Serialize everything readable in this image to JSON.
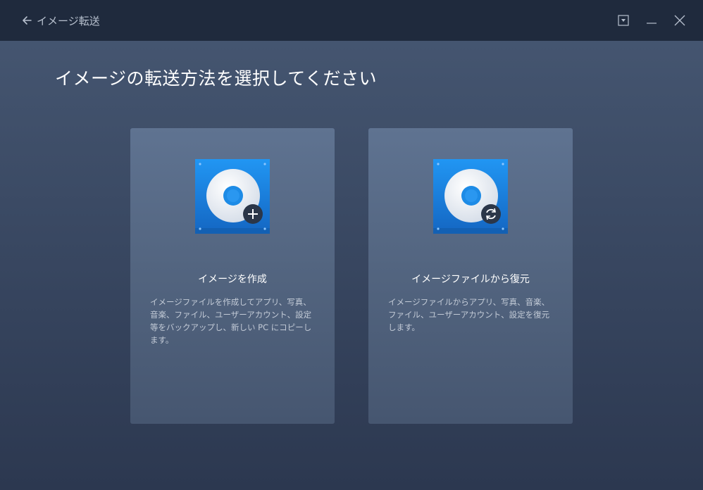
{
  "titlebar": {
    "back_label": "イメージ転送"
  },
  "page": {
    "title": "イメージの転送方法を選択してください"
  },
  "cards": [
    {
      "title": "イメージを作成",
      "description": "イメージファイルを作成してアプリ、写真、音楽、ファイル、ユーザーアカウント、設定等をバックアップし、新しい PC にコピーします。",
      "icon": "disk-plus-icon"
    },
    {
      "title": "イメージファイルから復元",
      "description": "イメージファイルからアプリ、写真、音楽、ファイル、ユーザーアカウント、設定を復元します。",
      "icon": "disk-restore-icon"
    }
  ],
  "colors": {
    "titlebar_bg": "#1f2a3d",
    "window_bg_top": "#475873",
    "window_bg_bottom": "#2c3850",
    "card_bg": "#5f7391",
    "icon_blue": "#1d8be6"
  }
}
